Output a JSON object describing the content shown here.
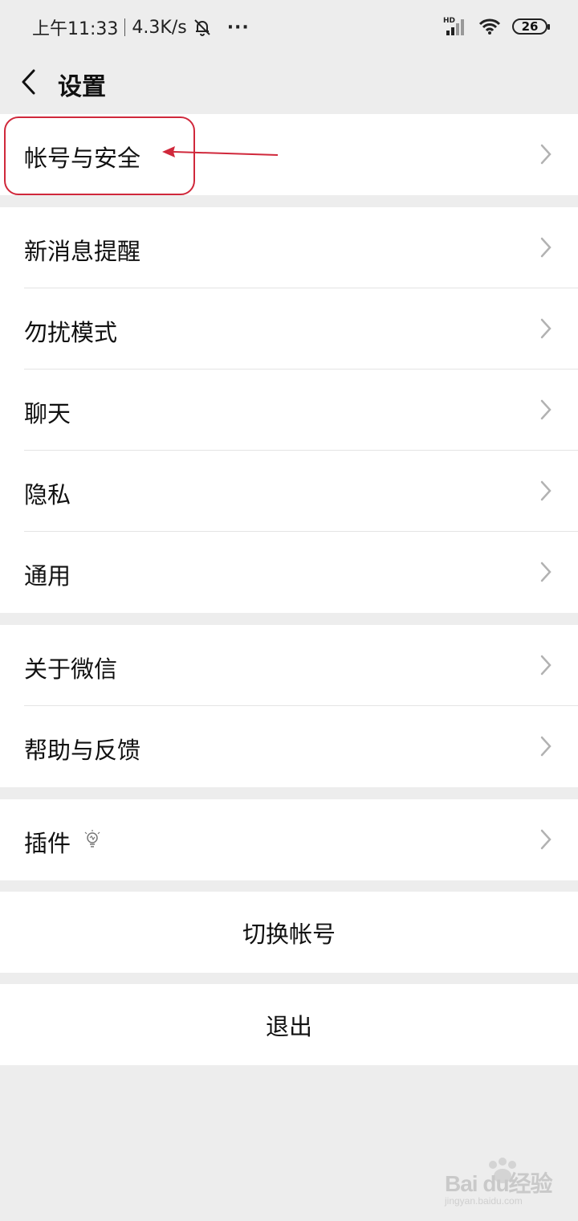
{
  "status_bar": {
    "time": "上午11:33",
    "speed": "4.3K/s",
    "more": "···",
    "network_label": "HD",
    "battery": "26"
  },
  "header": {
    "title": "设置"
  },
  "groups": {
    "account": [
      "帐号与安全"
    ],
    "main": [
      "新消息提醒",
      "勿扰模式",
      "聊天",
      "隐私",
      "通用"
    ],
    "about": [
      "关于微信",
      "帮助与反馈"
    ],
    "plugins": [
      "插件"
    ]
  },
  "actions": {
    "switch_account": "切换帐号",
    "logout": "退出"
  },
  "annotation": {
    "color": "#d0283b"
  },
  "watermark": {
    "brand": "Bai du经验",
    "url": "jingyan.baidu.com"
  }
}
